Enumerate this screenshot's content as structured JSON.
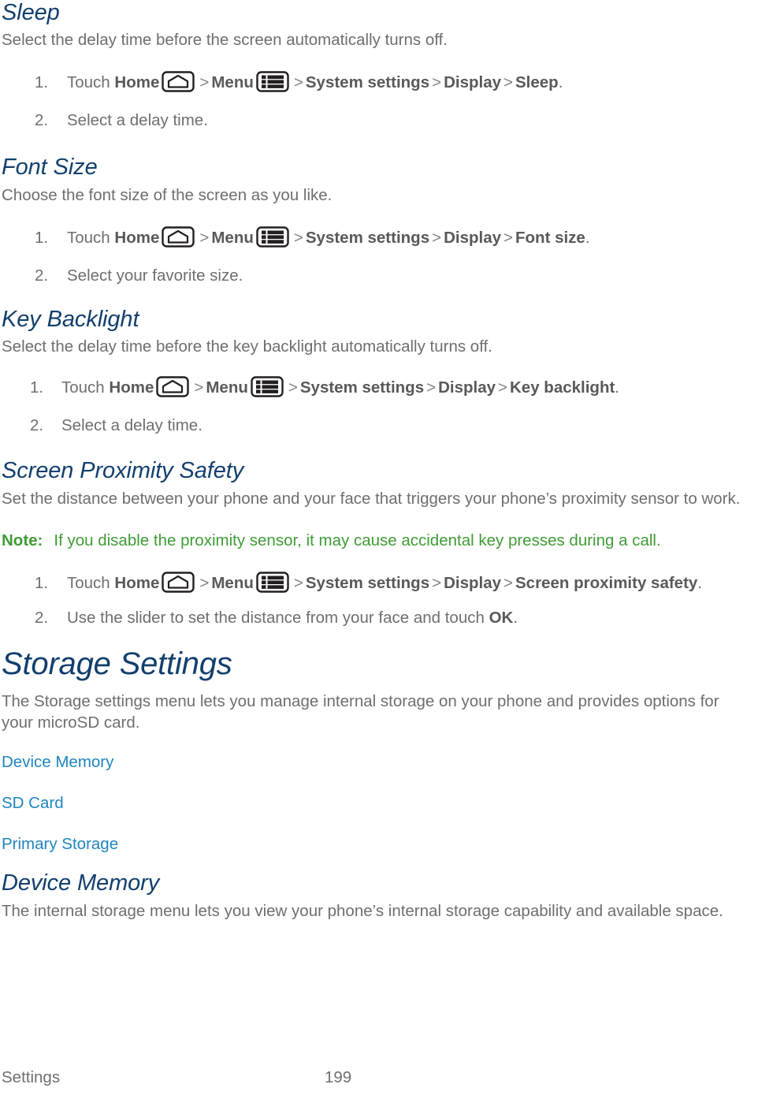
{
  "document": {
    "footer_left": "Settings",
    "page_number": "199"
  },
  "colors": {
    "heading_navy": "#123f6d",
    "body_gray": "#6d6e70",
    "bold_gray": "#58595b",
    "link_blue": "#1e85c0",
    "note_green": "#3f9c35"
  },
  "icons": {
    "home": "home-icon",
    "menu": "menu-icon"
  },
  "sections": {
    "sleep": {
      "heading": "Sleep",
      "intro": "Select the delay time before the screen automatically turns off.",
      "step1": {
        "num": "1.",
        "touch": "Touch ",
        "home": "Home",
        "menu": "Menu",
        "gt1": ">",
        "gt2": ">",
        "gt3": ">",
        "gt4": ">",
        "system_settings": "System settings",
        "display": "Display",
        "target": "Sleep",
        "period": "."
      },
      "step2": {
        "num": "2.",
        "text": "Select a delay time."
      }
    },
    "font_size": {
      "heading": "Font Size",
      "intro": "Choose the font size of the screen as you like.",
      "step1": {
        "num": "1.",
        "touch": "Touch ",
        "home": "Home",
        "menu": "Menu",
        "gt1": ">",
        "gt2": ">",
        "gt3": ">",
        "gt4": ">",
        "system_settings": "System settings",
        "display": "Display",
        "target": "Font size",
        "period": "."
      },
      "step2": {
        "num": "2.",
        "text": "Select your favorite size."
      }
    },
    "key_backlight": {
      "heading": "Key Backlight",
      "intro": "Select the delay time before the key backlight automatically turns off.",
      "step1": {
        "num": "1.",
        "touch": "Touch ",
        "home": "Home",
        "menu": "Menu",
        "gt1": ">",
        "gt2": ">",
        "gt3": ">",
        "gt4": ">",
        "system_settings": "System settings",
        "display": "Display",
        "target": "Key backlight",
        "period": "."
      },
      "step2": {
        "num": "2.",
        "text": "Select a delay time."
      }
    },
    "screen_proximity_safety": {
      "heading": "Screen Proximity Safety",
      "intro": "Set the distance between your phone and your face that triggers your phone’s proximity sensor to work.",
      "note": {
        "label": "Note:",
        "text": "If you disable the proximity sensor, it may cause accidental key presses during a call."
      },
      "step1": {
        "num": "1.",
        "touch": "Touch ",
        "home": "Home",
        "menu": "Menu",
        "gt1": ">",
        "gt2": ">",
        "gt3": ">",
        "gt4": ">",
        "system_settings": "System settings",
        "display": "Display",
        "target": "Screen proximity safety",
        "period": "."
      },
      "step2": {
        "num": "2.",
        "text_before": "Use the slider to set the distance from your face and touch ",
        "bold": "OK",
        "text_after": "."
      }
    },
    "storage_settings": {
      "heading": "Storage Settings",
      "intro": "The Storage settings menu lets you manage internal storage on your phone and provides options for your microSD card.",
      "links": [
        {
          "label": "Device Memory"
        },
        {
          "label": "SD Card"
        },
        {
          "label": "Primary Storage"
        }
      ]
    },
    "device_memory": {
      "heading": "Device Memory",
      "intro": "The internal storage menu lets you view your phone’s internal storage capability and available space."
    }
  }
}
